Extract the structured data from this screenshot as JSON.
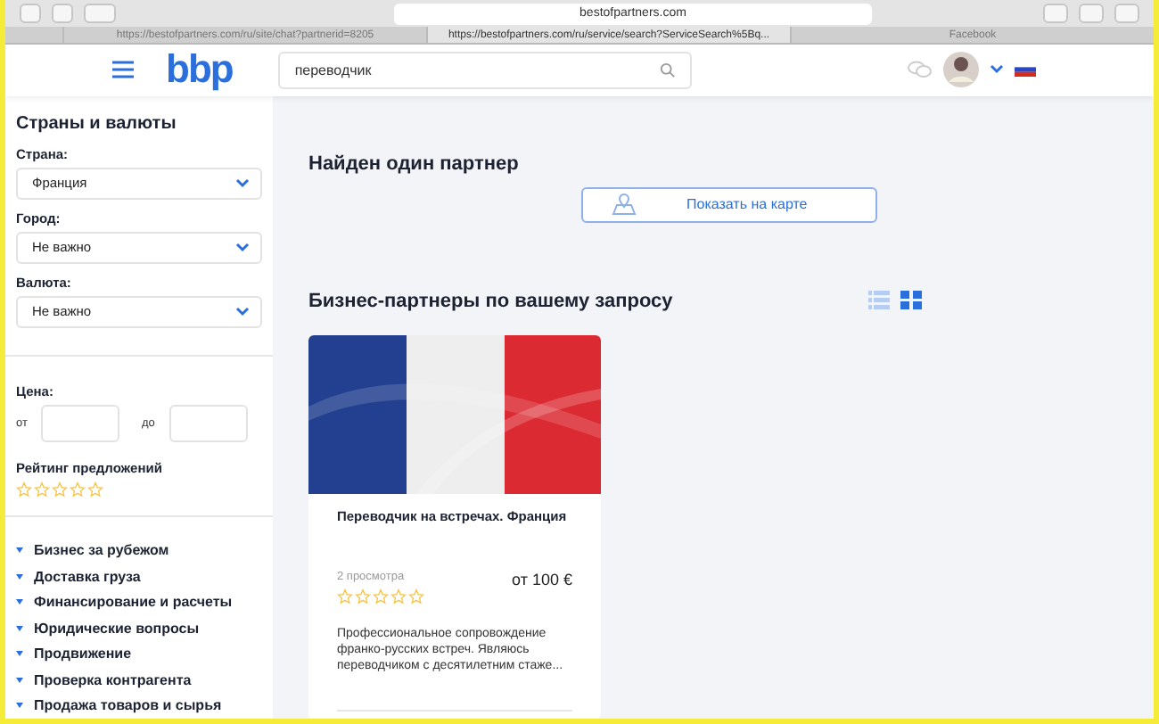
{
  "browser": {
    "address": "bestofpartners.com",
    "tabs": [
      {
        "label": "https://bestofpartners.com/ru/site/chat?partnerid=8205",
        "selected": false
      },
      {
        "label": "https://bestofpartners.com/ru/service/search?ServiceSearch%5Bq...",
        "selected": true
      },
      {
        "label": "Facebook",
        "selected": false
      }
    ]
  },
  "header": {
    "logo": "bbp",
    "search": {
      "value": "переводчик"
    }
  },
  "sidebar": {
    "title": "Страны и валюты",
    "selects": [
      {
        "label": "Страна:",
        "value": "Франция"
      },
      {
        "label": "Город:",
        "value": "Не важно"
      },
      {
        "label": "Валюта:",
        "value": "Не важно"
      }
    ],
    "price": {
      "label": "Цена:",
      "from": "от",
      "to": "до"
    },
    "rating": {
      "label": "Рейтинг предложений",
      "stars": 0
    },
    "categories": [
      "Бизнес за рубежом",
      "Доставка груза",
      "Финансирование и расчеты",
      "Юридические вопросы",
      "Продвижение",
      "Проверка контрагента",
      "Продажа товаров и сырья"
    ]
  },
  "main": {
    "found": "Найден один партнер",
    "map_button": "Показать на карте",
    "heading": "Бизнес-партнеры по вашему запросу",
    "views": [
      {
        "kind": "list",
        "selected": false
      },
      {
        "kind": "grid",
        "selected": true
      }
    ],
    "cards": [
      {
        "title": "Переводчик на встречах. Франция",
        "views": "2 просмотра",
        "price": "от 100 €",
        "stars": 0,
        "description": "Профессиональное сопровождение франко-русских встреч. Являюсь переводчиком с десятилетним стаже..."
      }
    ]
  }
}
